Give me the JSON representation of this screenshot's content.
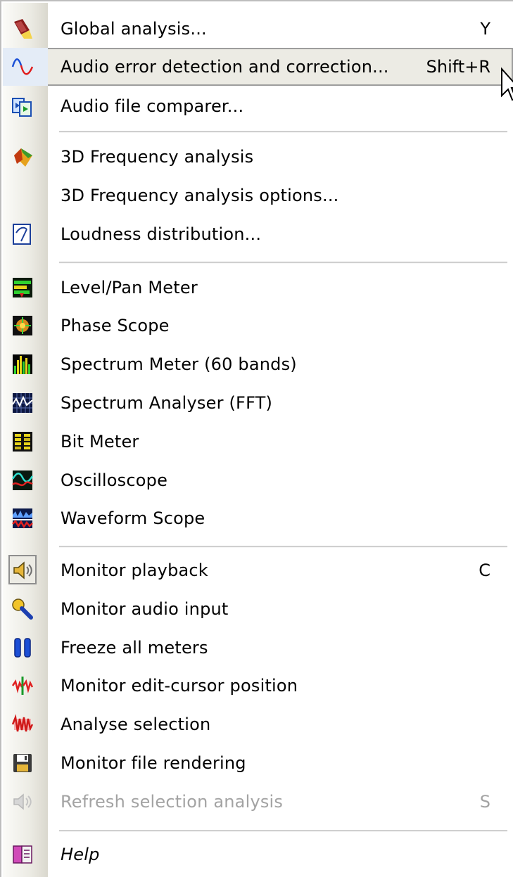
{
  "menu": {
    "items": [
      {
        "label": "Global analysis...",
        "mnemonic": "G",
        "shortcut": "Y",
        "icon": "flashlight-icon"
      },
      {
        "label": "Audio error detection and correction...",
        "mnemonic": "A",
        "shortcut": "Shift+R",
        "icon": "sine-wave-icon",
        "highlighted": true
      },
      {
        "label": "Audio file comparer...",
        "mnemonic": "u",
        "shortcut": "",
        "icon": "file-compare-icon"
      },
      {
        "label": "3D Frequency analysis",
        "mnemonic": "3",
        "shortcut": "",
        "icon": "3d-frequency-icon"
      },
      {
        "label": "3D Frequency analysis options...",
        "mnemonic": "D",
        "shortcut": "",
        "icon": ""
      },
      {
        "label": "Loudness distribution...",
        "mnemonic": "L",
        "shortcut": "",
        "icon": "loudness-curve-icon"
      },
      {
        "label": "Level/Pan Meter",
        "mnemonic": "e",
        "shortcut": "",
        "icon": "level-meter-icon"
      },
      {
        "label": "Phase Scope",
        "mnemonic": "P",
        "shortcut": "",
        "icon": "phase-scope-icon"
      },
      {
        "label": "Spectrum Meter (60 bands)",
        "mnemonic": "S",
        "shortcut": "",
        "icon": "spectrum-meter-icon"
      },
      {
        "label": "Spectrum Analyser (FFT)",
        "mnemonic": "c",
        "shortcut": "",
        "icon": "spectrum-analyser-icon"
      },
      {
        "label": "Bit Meter",
        "mnemonic": "B",
        "shortcut": "",
        "icon": "bit-meter-icon"
      },
      {
        "label": "Oscilloscope",
        "mnemonic": "O",
        "shortcut": "",
        "icon": "oscilloscope-icon"
      },
      {
        "label": "Waveform Scope",
        "mnemonic": "W",
        "shortcut": "",
        "icon": "waveform-scope-icon"
      },
      {
        "label": "Monitor playback",
        "mnemonic": "M",
        "shortcut": "C",
        "icon": "speaker-icon",
        "checked": true
      },
      {
        "label": "Monitor audio input",
        "mnemonic": "n",
        "shortcut": "",
        "icon": "microphone-icon"
      },
      {
        "label": "Freeze all meters",
        "mnemonic": "F",
        "shortcut": "",
        "icon": "pause-icon"
      },
      {
        "label": "Monitor edit-cursor position",
        "mnemonic": "t",
        "shortcut": "",
        "icon": "edit-cursor-icon"
      },
      {
        "label": "Analyse selection",
        "mnemonic": "y",
        "shortcut": "",
        "icon": "analyse-selection-icon"
      },
      {
        "label": "Monitor file rendering",
        "mnemonic": "t",
        "shortcut": "",
        "icon": "floppy-disk-icon"
      },
      {
        "label": "Refresh selection analysis",
        "mnemonic": "R",
        "shortcut": "S",
        "icon": "refresh-speaker-icon",
        "disabled": true
      },
      {
        "label": "Help",
        "mnemonic": "H",
        "shortcut": "",
        "icon": "help-book-icon"
      }
    ]
  },
  "colors": {
    "gutter": "#ecebe4",
    "highlight_border": "#9d9d9d",
    "disabled_text": "#a3a3a3",
    "separator": "#cfcfcf"
  }
}
